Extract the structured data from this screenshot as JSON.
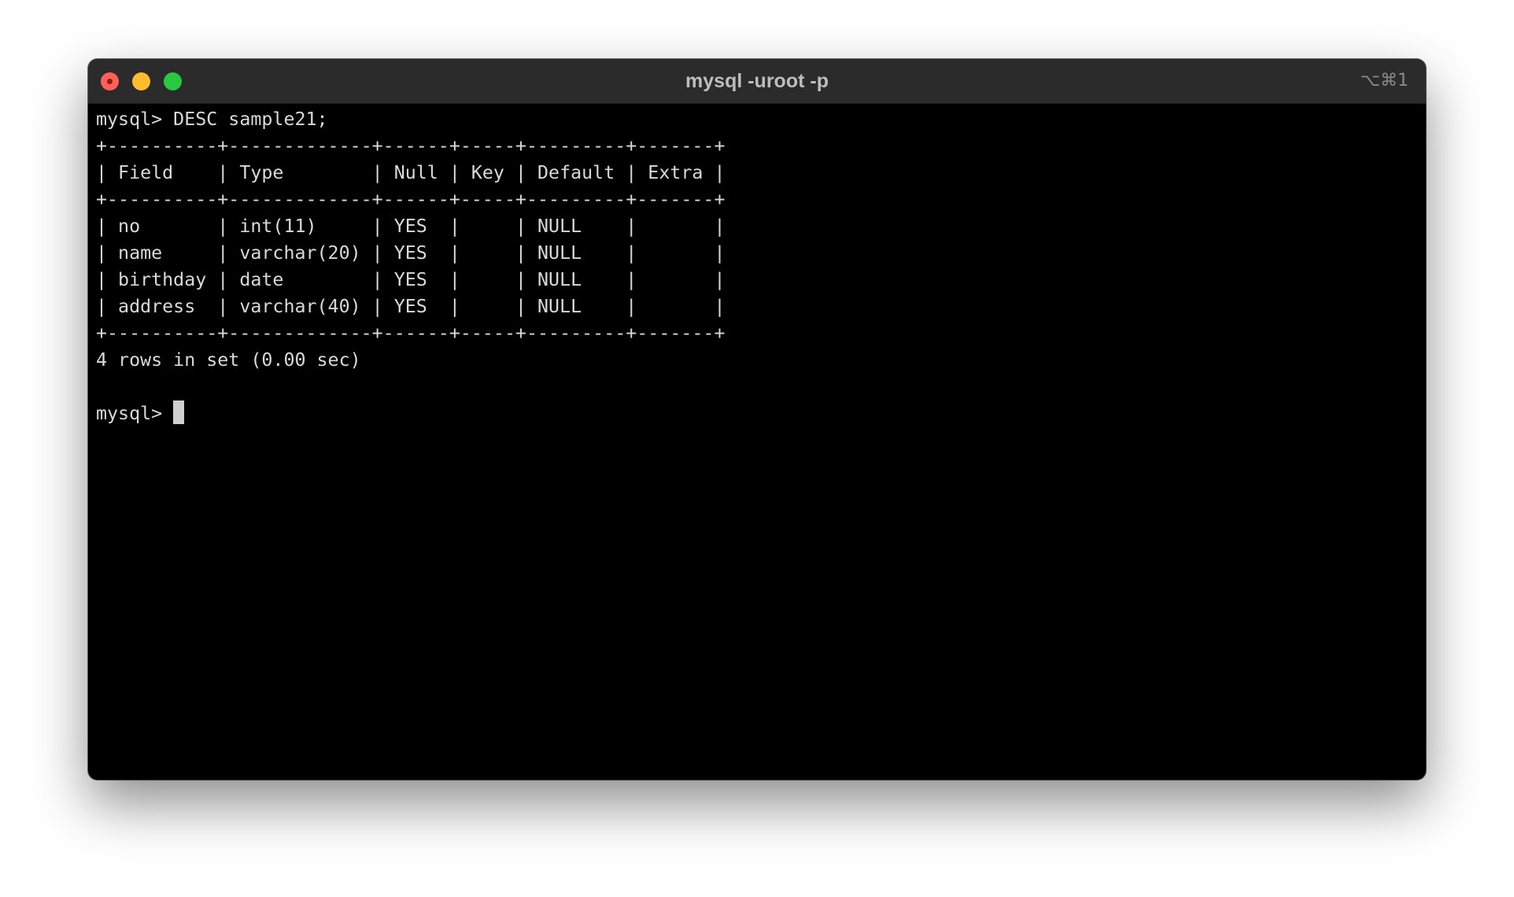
{
  "window": {
    "title": "mysql -uroot -p",
    "shortcut": "⌥⌘1"
  },
  "terminal": {
    "lines": [
      "mysql> DESC sample21;",
      "+----------+-------------+------+-----+---------+-------+",
      "| Field    | Type        | Null | Key | Default | Extra |",
      "+----------+-------------+------+-----+---------+-------+",
      "| no       | int(11)     | YES  |     | NULL    |       |",
      "| name     | varchar(20) | YES  |     | NULL    |       |",
      "| birthday | date        | YES  |     | NULL    |       |",
      "| address  | varchar(40) | YES  |     | NULL    |       |",
      "+----------+-------------+------+-----+---------+-------+",
      "4 rows in set (0.00 sec)",
      ""
    ],
    "prompt": "mysql> "
  }
}
